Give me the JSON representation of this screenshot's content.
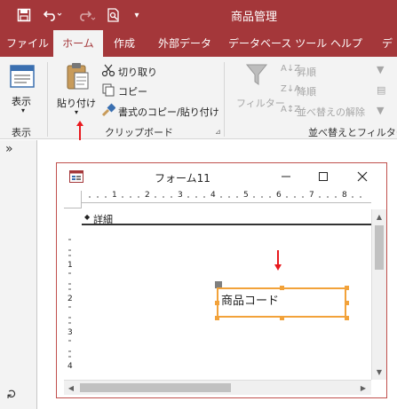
{
  "app": {
    "title": "商品管理"
  },
  "tabs": [
    "ファイル",
    "ホーム",
    "作成",
    "外部データ",
    "データベース ツール",
    "ヘルプ",
    "デ"
  ],
  "ribbon": {
    "view": {
      "label": "表示",
      "group": "表示"
    },
    "clipboard": {
      "paste": "貼り付け",
      "cut": "切り取り",
      "copy": "コピー",
      "format_painter": "書式のコピー/貼り付け",
      "group": "クリップボード"
    },
    "sort_filter": {
      "filter": "フィルター",
      "ascending": "昇順",
      "descending": "降順",
      "clear_sort": "並べ替えの解除",
      "group": "並べ替えとフィルター"
    }
  },
  "navpane": {
    "toggle": "»"
  },
  "form": {
    "title": "フォーム11",
    "section": "詳細",
    "control_label": "商品コード",
    "ruler_numbers": [
      "1",
      "2",
      "3",
      "4",
      "5",
      "6",
      "7",
      "8"
    ],
    "left_ruler_numbers": [
      "1",
      "2",
      "3",
      "4"
    ]
  },
  "colors": {
    "accent": "#a4373a",
    "selection": "#f2a23a",
    "annotation_arrow": "#e8191e"
  }
}
